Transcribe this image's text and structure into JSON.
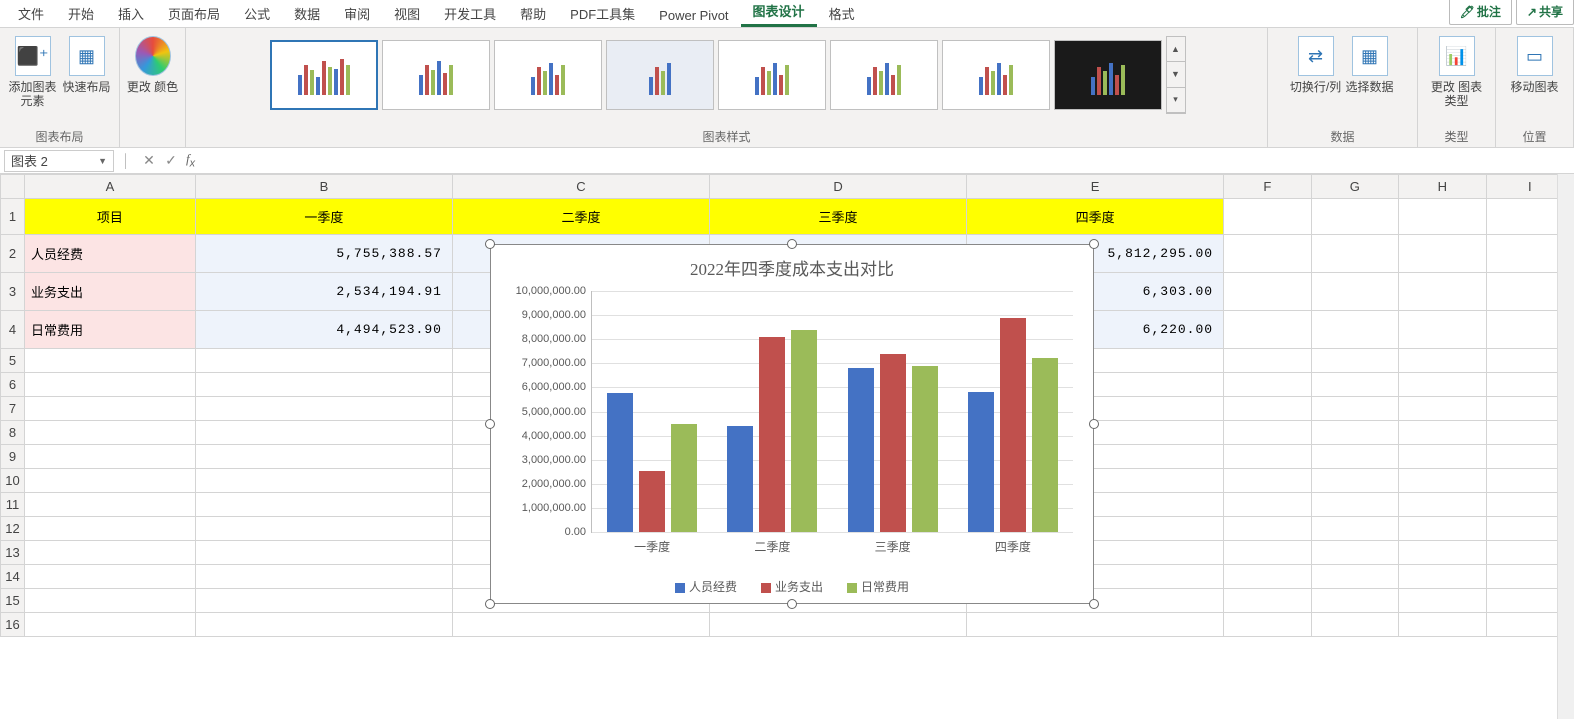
{
  "ribbon": {
    "tabs": [
      "文件",
      "开始",
      "插入",
      "页面布局",
      "公式",
      "数据",
      "审阅",
      "视图",
      "开发工具",
      "帮助",
      "PDF工具集",
      "Power Pivot",
      "图表设计",
      "格式"
    ],
    "active_tab": "图表设计",
    "right_buttons": {
      "comment": "批注",
      "share": "共享"
    },
    "groups": {
      "layout": {
        "add_element": "添加图表\n元素",
        "quick_layout": "快速布局",
        "label": "图表布局"
      },
      "colors": {
        "change_colors": "更改\n颜色"
      },
      "styles_label": "图表样式",
      "data": {
        "switch": "切换行/列",
        "select": "选择数据",
        "label": "数据"
      },
      "type": {
        "change_type": "更改\n图表类型",
        "label": "类型"
      },
      "location": {
        "move": "移动图表",
        "label": "位置"
      }
    }
  },
  "namebox": "图表 2",
  "columns": [
    "A",
    "B",
    "C",
    "D",
    "E",
    "F",
    "G",
    "H",
    "I"
  ],
  "table": {
    "headers": [
      "项目",
      "一季度",
      "二季度",
      "三季度",
      "四季度"
    ],
    "rows": [
      {
        "label": "人员经费",
        "vals": [
          "5,755,388.57",
          "4,415,893.00",
          "6,812,697.00",
          "5,812,295.00"
        ]
      },
      {
        "label": "业务支出",
        "vals": [
          "2,534,194.91",
          "",
          "",
          "6,303.00"
        ],
        "hidden_full": [
          "2,534,194.91",
          "8,100,000.00",
          "7,400,000.00",
          "8,906,303.00"
        ]
      },
      {
        "label": "日常费用",
        "vals": [
          "4,494,523.90",
          "",
          "",
          "6,220.00"
        ],
        "hidden_full": [
          "4,494,523.90",
          "8,400,000.00",
          "6,900,000.00",
          "7,206,220.00"
        ]
      }
    ]
  },
  "chart_data": {
    "type": "bar",
    "title": "2022年四季度成本支出对比",
    "categories": [
      "一季度",
      "二季度",
      "三季度",
      "四季度"
    ],
    "series": [
      {
        "name": "人员经费",
        "values": [
          5755388.57,
          4415893.0,
          6812697.0,
          5812295.0
        ],
        "color": "#4472c4"
      },
      {
        "name": "业务支出",
        "values": [
          2534194.91,
          8100000.0,
          7400000.0,
          8900000.0
        ],
        "color": "#c0504d"
      },
      {
        "name": "日常费用",
        "values": [
          4494523.9,
          8400000.0,
          6900000.0,
          7200000.0
        ],
        "color": "#9bbb59"
      }
    ],
    "ylim": [
      0,
      10000000
    ],
    "yticks": [
      "0.00",
      "1,000,000.00",
      "2,000,000.00",
      "3,000,000.00",
      "4,000,000.00",
      "5,000,000.00",
      "6,000,000.00",
      "7,000,000.00",
      "8,000,000.00",
      "9,000,000.00",
      "10,000,000.00"
    ]
  }
}
